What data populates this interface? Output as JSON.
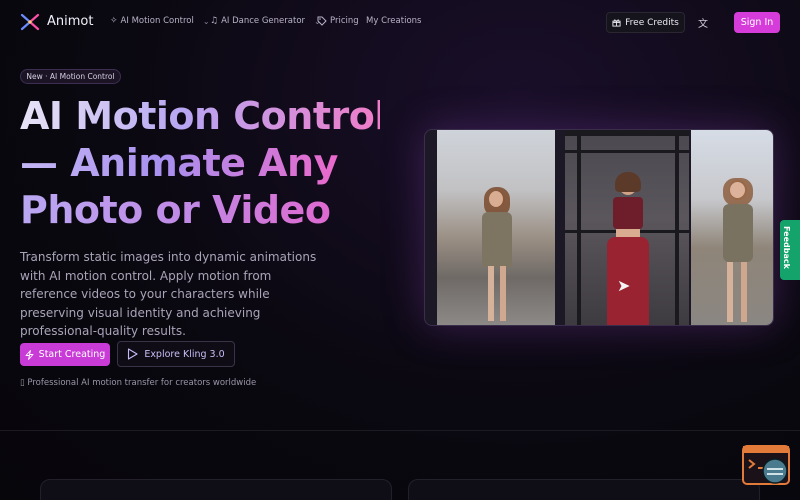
{
  "nav": {
    "brand": "Animot",
    "items": [
      {
        "label": "AI Motion Control",
        "icon": "sparkles-icon",
        "dropdown": true
      },
      {
        "label": "AI Dance Generator",
        "icon": "music-note-icon",
        "dropdown": true
      },
      {
        "label": "Pricing",
        "icon": "tag-icon",
        "dropdown": false
      },
      {
        "label": "My Creations",
        "icon": "",
        "dropdown": false
      }
    ],
    "free_credits": "Free Credits",
    "sign_in": "Sign In"
  },
  "hero": {
    "badge": "New · AI Motion Control",
    "title_lines": [
      "AI Motion Control",
      "— Animate Any",
      "Photo or Video"
    ],
    "description": "Transform static images into dynamic animations with AI motion control. Apply motion from reference videos to your characters while preserving visual identity and achieving professional-quality results.",
    "start_button": "Start Creating",
    "explore_button": "Explore Kling 3.0",
    "tagline": "Professional AI motion transfer for creators worldwide"
  },
  "feedback_label": "Feedback",
  "colors": {
    "accent": "#d63cd9",
    "background": "#0a0810",
    "feedback": "#13a36b"
  }
}
